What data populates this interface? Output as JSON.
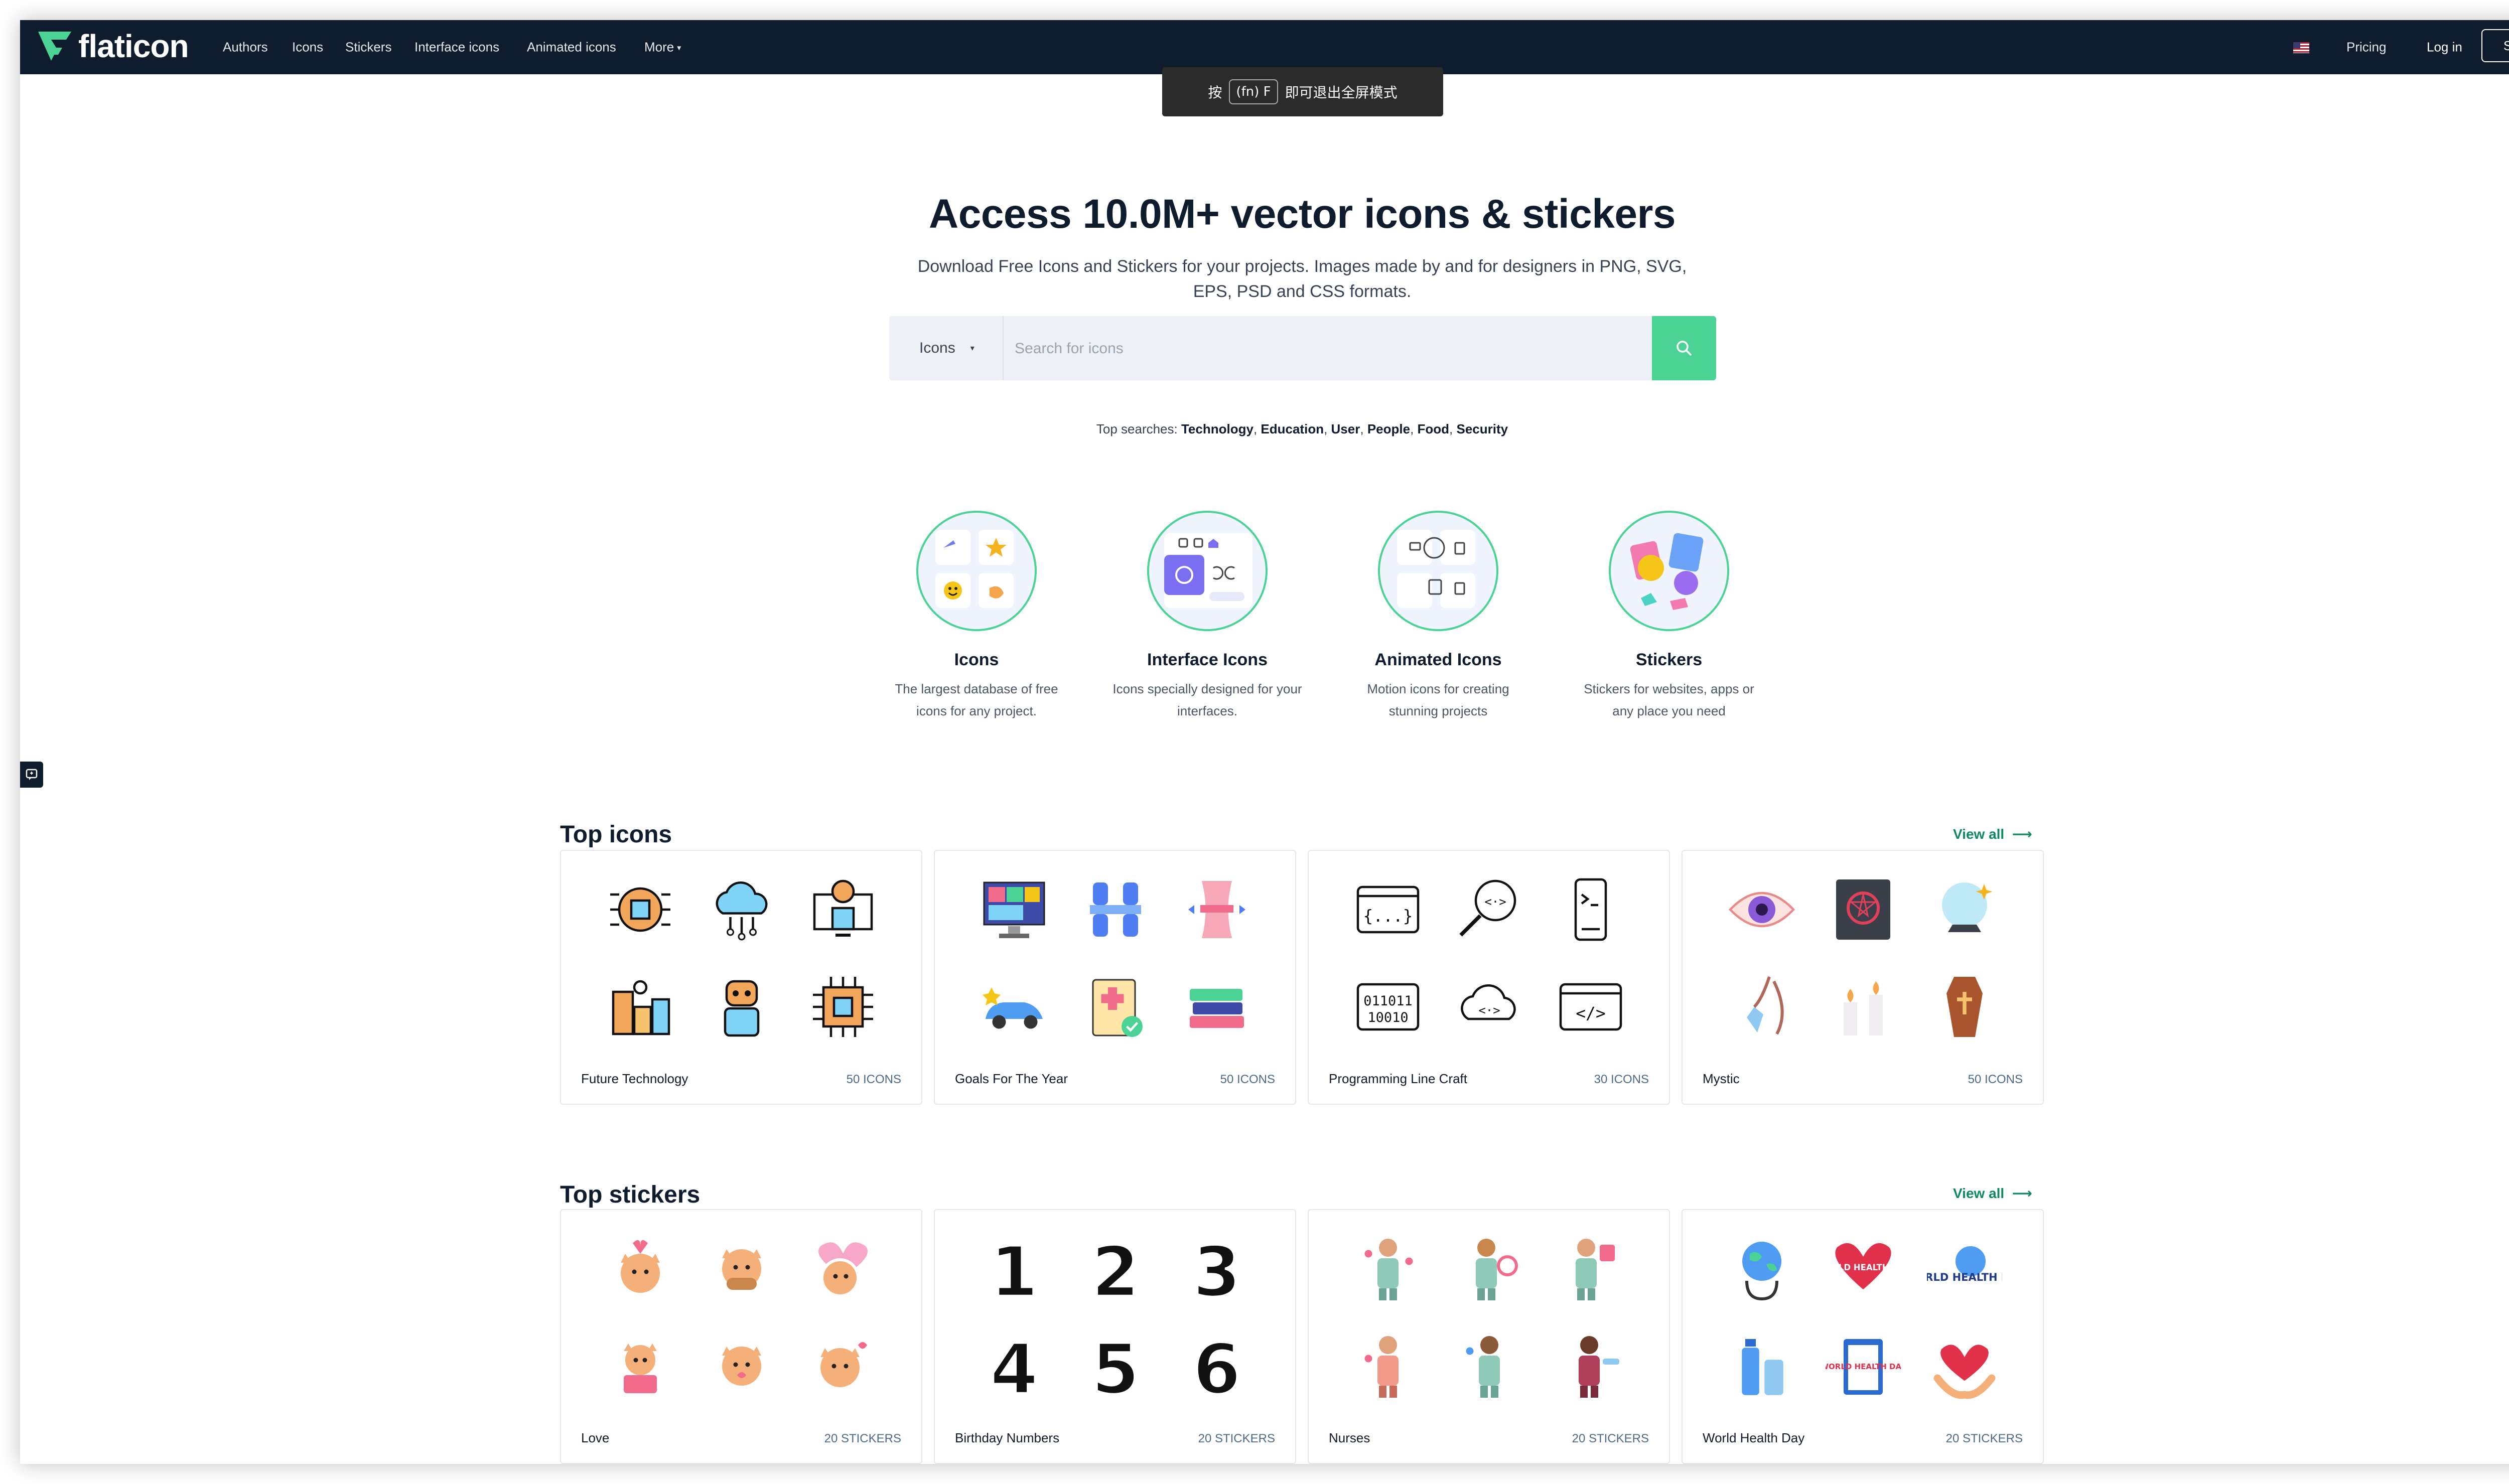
{
  "header": {
    "logo_text": "flaticon",
    "nav": [
      "Authors",
      "Icons",
      "Stickers",
      "Interface icons",
      "Animated icons",
      "More"
    ],
    "flag_icon": "us-flag-icon",
    "pricing": "Pricing",
    "login": "Log in",
    "signup": "Sign up",
    "colors": {
      "bar": "#0f1c2e",
      "accent": "#4ad395"
    }
  },
  "toast": {
    "prefix": "按",
    "key": "(fn) F",
    "suffix": "即可退出全屏模式"
  },
  "hero": {
    "title": "Access 10.0M+ vector icons & stickers",
    "subtitle": "Download Free Icons and Stickers for your projects. Images made by and for designers in PNG, SVG, EPS, PSD and CSS formats.",
    "search_type": "Icons",
    "search_placeholder": "Search for icons",
    "top_searches_label": "Top searches:",
    "top_searches": [
      "Technology",
      "Education",
      "User",
      "People",
      "Food",
      "Security"
    ]
  },
  "categories": [
    {
      "title": "Icons",
      "desc": "The largest database of free icons for any project."
    },
    {
      "title": "Interface Icons",
      "desc": "Icons specially designed for your interfaces."
    },
    {
      "title": "Animated Icons",
      "desc": "Motion icons for creating stunning projects"
    },
    {
      "title": "Stickers",
      "desc": "Stickers for websites, apps or any place you need"
    }
  ],
  "top_icons": {
    "title": "Top icons",
    "view_all": "View all",
    "packs": [
      {
        "name": "Future Technology",
        "count": "50 ICONS"
      },
      {
        "name": "Goals For The Year",
        "count": "50 ICONS"
      },
      {
        "name": "Programming Line Craft",
        "count": "30 ICONS"
      },
      {
        "name": "Mystic",
        "count": "50 ICONS"
      }
    ]
  },
  "top_stickers": {
    "title": "Top stickers",
    "view_all": "View all",
    "packs": [
      {
        "name": "Love",
        "count": "20 STICKERS"
      },
      {
        "name": "Birthday Numbers",
        "count": "20 STICKERS"
      },
      {
        "name": "Nurses",
        "count": "20 STICKERS"
      },
      {
        "name": "World Health Day",
        "count": "20 STICKERS"
      }
    ]
  },
  "sticker_text": {
    "numbers": [
      "1",
      "2",
      "3",
      "4",
      "5",
      "6"
    ],
    "world_health": "WORLD HEALTH DAY"
  }
}
